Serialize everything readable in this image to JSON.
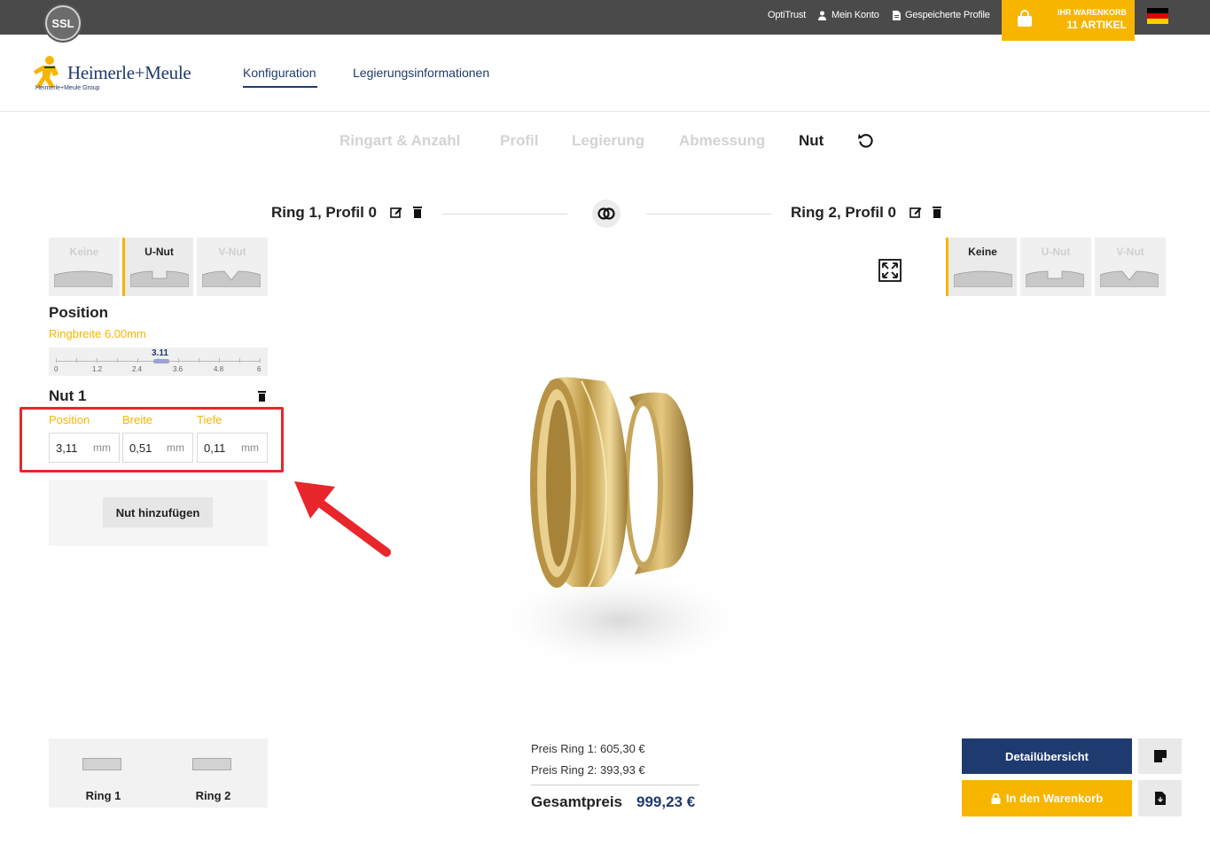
{
  "topbar": {
    "ssl_badge": "SSL",
    "links": [
      "OptiTrust",
      "Mein Konto",
      "Gespeicherte Profile"
    ],
    "cart_label": "IHR WARENKORB",
    "cart_count": "11 ARTIKEL",
    "language_icon": "german-flag-icon"
  },
  "header": {
    "logo_text": "Heimerle+Meule",
    "logo_sub": "Heimerle+Meule Group",
    "nav": [
      "Konfiguration",
      "Legierungsinformationen"
    ],
    "active_nav": "Konfiguration"
  },
  "steps": [
    "Ringart & Anzahl",
    "Profil",
    "Legierung",
    "Abmessung",
    "Nut"
  ],
  "active_step": "Nut",
  "ring1": {
    "title": "Ring 1, Profil 0",
    "groove_types": [
      "Keine",
      "U-Nut",
      "V-Nut"
    ],
    "selected_groove": "U-Nut"
  },
  "ring2": {
    "title": "Ring 2, Profil 0",
    "groove_types": [
      "Keine",
      "U-Nut",
      "V-Nut"
    ],
    "selected_groove": "Keine"
  },
  "position": {
    "heading": "Position",
    "ring_width": "Ringbreite 6.00mm",
    "slider_value": "3.11",
    "slider_value_num": 3.11,
    "slider_min": 0,
    "slider_max": 6,
    "slider_ticks": [
      "0",
      "1.2",
      "2.4",
      "3.6",
      "4.8",
      "6"
    ]
  },
  "nut1": {
    "heading": "Nut 1",
    "fields": [
      {
        "label": "Position",
        "value": "3,11",
        "unit": "mm"
      },
      {
        "label": "Breite",
        "value": "0,51",
        "unit": "mm"
      },
      {
        "label": "Tiefe",
        "value": "0,11",
        "unit": "mm"
      }
    ]
  },
  "add_button": "Nut hinzufügen",
  "ring_selector": [
    "Ring 1",
    "Ring 2"
  ],
  "prices": {
    "ring1": "Preis Ring 1: 605,30 €",
    "ring2": "Preis Ring 2: 393,93 €",
    "total_label": "Gesamtpreis",
    "total_value": "999,23 €"
  },
  "actions": {
    "detail": "Detailübersicht",
    "cart": "In den Warenkorb"
  },
  "colors": {
    "accent": "#f7b500",
    "brand": "#1f3a6e",
    "highlight": "#e8262b"
  }
}
